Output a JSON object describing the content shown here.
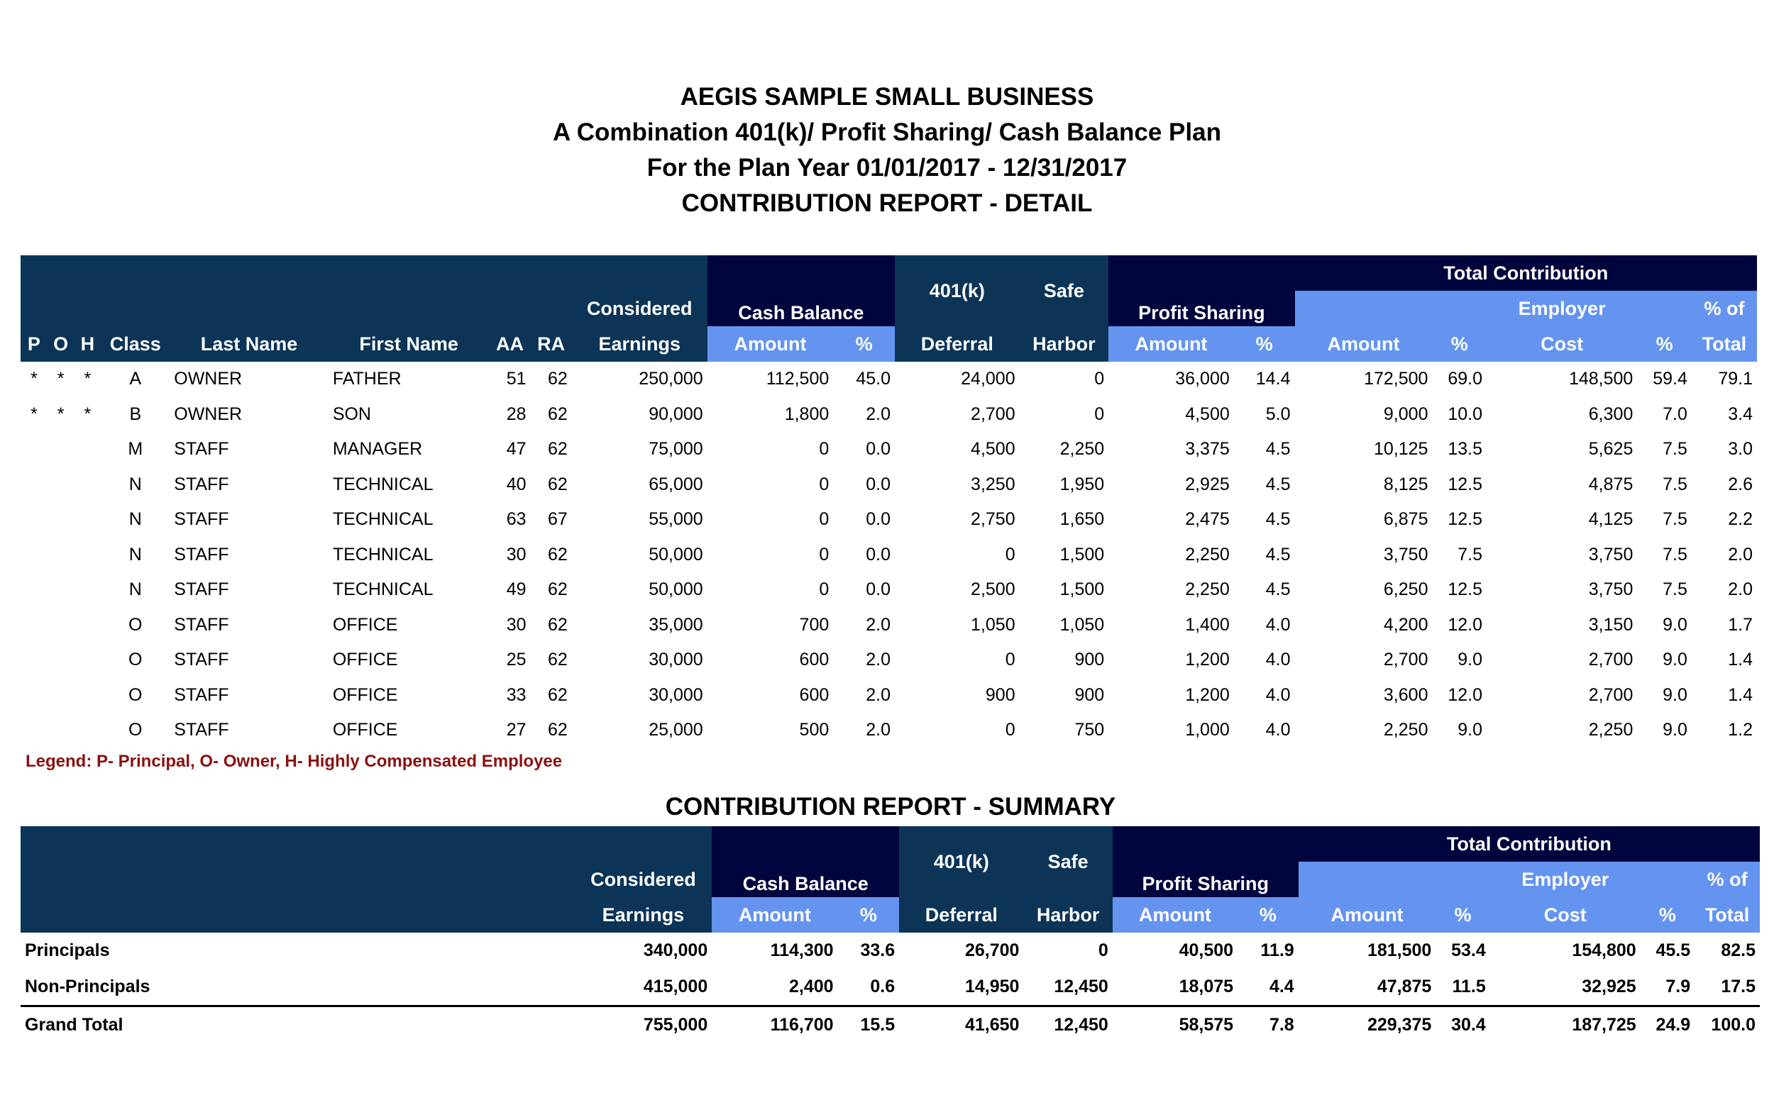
{
  "report": {
    "company": "AEGIS SAMPLE SMALL BUSINESS",
    "plan": "A Combination 401(k)/ Profit Sharing/ Cash Balance Plan",
    "plan_year": "For the Plan Year 01/01/2017 - 12/31/2017",
    "detail_title": "CONTRIBUTION REPORT - DETAIL",
    "summary_title": "CONTRIBUTION REPORT - SUMMARY",
    "legend": "Legend: P- Principal, O- Owner, H- Highly Compensated Employee"
  },
  "headers": {
    "total_contribution": "Total Contribution",
    "considered": "Considered",
    "earnings": "Earnings",
    "cash_balance": "Cash Balance",
    "k401": "401(k)",
    "deferral": "Deferral",
    "safe": "Safe",
    "harbor": "Harbor",
    "profit_sharing": "Profit Sharing",
    "amount": "Amount",
    "pct": "%",
    "employer": "Employer",
    "cost": "Cost",
    "pct_of": "% of",
    "total": "Total",
    "p": "P",
    "o": "O",
    "h": "H",
    "class": "Class",
    "last_name": "Last Name",
    "first_name": "First Name",
    "aa": "AA",
    "ra": "RA"
  },
  "detail_rows": [
    {
      "p": "*",
      "o": "*",
      "h": "*",
      "cls": "A",
      "last": "OWNER",
      "first": "FATHER",
      "aa": "51",
      "ra": "62",
      "earn": "250,000",
      "cb_amt": "112,500",
      "cb_pct": "45.0",
      "def": "24,000",
      "sh": "0",
      "ps_amt": "36,000",
      "ps_pct": "14.4",
      "tc_amt": "172,500",
      "tc_pct": "69.0",
      "er_cost": "148,500",
      "er_pct": "59.4",
      "pct_total": "79.1"
    },
    {
      "p": "*",
      "o": "*",
      "h": "*",
      "cls": "B",
      "last": "OWNER",
      "first": "SON",
      "aa": "28",
      "ra": "62",
      "earn": "90,000",
      "cb_amt": "1,800",
      "cb_pct": "2.0",
      "def": "2,700",
      "sh": "0",
      "ps_amt": "4,500",
      "ps_pct": "5.0",
      "tc_amt": "9,000",
      "tc_pct": "10.0",
      "er_cost": "6,300",
      "er_pct": "7.0",
      "pct_total": "3.4"
    },
    {
      "p": "",
      "o": "",
      "h": "",
      "cls": "M",
      "last": "STAFF",
      "first": "MANAGER",
      "aa": "47",
      "ra": "62",
      "earn": "75,000",
      "cb_amt": "0",
      "cb_pct": "0.0",
      "def": "4,500",
      "sh": "2,250",
      "ps_amt": "3,375",
      "ps_pct": "4.5",
      "tc_amt": "10,125",
      "tc_pct": "13.5",
      "er_cost": "5,625",
      "er_pct": "7.5",
      "pct_total": "3.0"
    },
    {
      "p": "",
      "o": "",
      "h": "",
      "cls": "N",
      "last": "STAFF",
      "first": "TECHNICAL",
      "aa": "40",
      "ra": "62",
      "earn": "65,000",
      "cb_amt": "0",
      "cb_pct": "0.0",
      "def": "3,250",
      "sh": "1,950",
      "ps_amt": "2,925",
      "ps_pct": "4.5",
      "tc_amt": "8,125",
      "tc_pct": "12.5",
      "er_cost": "4,875",
      "er_pct": "7.5",
      "pct_total": "2.6"
    },
    {
      "p": "",
      "o": "",
      "h": "",
      "cls": "N",
      "last": "STAFF",
      "first": "TECHNICAL",
      "aa": "63",
      "ra": "67",
      "earn": "55,000",
      "cb_amt": "0",
      "cb_pct": "0.0",
      "def": "2,750",
      "sh": "1,650",
      "ps_amt": "2,475",
      "ps_pct": "4.5",
      "tc_amt": "6,875",
      "tc_pct": "12.5",
      "er_cost": "4,125",
      "er_pct": "7.5",
      "pct_total": "2.2"
    },
    {
      "p": "",
      "o": "",
      "h": "",
      "cls": "N",
      "last": "STAFF",
      "first": "TECHNICAL",
      "aa": "30",
      "ra": "62",
      "earn": "50,000",
      "cb_amt": "0",
      "cb_pct": "0.0",
      "def": "0",
      "sh": "1,500",
      "ps_amt": "2,250",
      "ps_pct": "4.5",
      "tc_amt": "3,750",
      "tc_pct": "7.5",
      "er_cost": "3,750",
      "er_pct": "7.5",
      "pct_total": "2.0"
    },
    {
      "p": "",
      "o": "",
      "h": "",
      "cls": "N",
      "last": "STAFF",
      "first": "TECHNICAL",
      "aa": "49",
      "ra": "62",
      "earn": "50,000",
      "cb_amt": "0",
      "cb_pct": "0.0",
      "def": "2,500",
      "sh": "1,500",
      "ps_amt": "2,250",
      "ps_pct": "4.5",
      "tc_amt": "6,250",
      "tc_pct": "12.5",
      "er_cost": "3,750",
      "er_pct": "7.5",
      "pct_total": "2.0"
    },
    {
      "p": "",
      "o": "",
      "h": "",
      "cls": "O",
      "last": "STAFF",
      "first": "OFFICE",
      "aa": "30",
      "ra": "62",
      "earn": "35,000",
      "cb_amt": "700",
      "cb_pct": "2.0",
      "def": "1,050",
      "sh": "1,050",
      "ps_amt": "1,400",
      "ps_pct": "4.0",
      "tc_amt": "4,200",
      "tc_pct": "12.0",
      "er_cost": "3,150",
      "er_pct": "9.0",
      "pct_total": "1.7"
    },
    {
      "p": "",
      "o": "",
      "h": "",
      "cls": "O",
      "last": "STAFF",
      "first": "OFFICE",
      "aa": "25",
      "ra": "62",
      "earn": "30,000",
      "cb_amt": "600",
      "cb_pct": "2.0",
      "def": "0",
      "sh": "900",
      "ps_amt": "1,200",
      "ps_pct": "4.0",
      "tc_amt": "2,700",
      "tc_pct": "9.0",
      "er_cost": "2,700",
      "er_pct": "9.0",
      "pct_total": "1.4"
    },
    {
      "p": "",
      "o": "",
      "h": "",
      "cls": "O",
      "last": "STAFF",
      "first": "OFFICE",
      "aa": "33",
      "ra": "62",
      "earn": "30,000",
      "cb_amt": "600",
      "cb_pct": "2.0",
      "def": "900",
      "sh": "900",
      "ps_amt": "1,200",
      "ps_pct": "4.0",
      "tc_amt": "3,600",
      "tc_pct": "12.0",
      "er_cost": "2,700",
      "er_pct": "9.0",
      "pct_total": "1.4"
    },
    {
      "p": "",
      "o": "",
      "h": "",
      "cls": "O",
      "last": "STAFF",
      "first": "OFFICE",
      "aa": "27",
      "ra": "62",
      "earn": "25,000",
      "cb_amt": "500",
      "cb_pct": "2.0",
      "def": "0",
      "sh": "750",
      "ps_amt": "1,000",
      "ps_pct": "4.0",
      "tc_amt": "2,250",
      "tc_pct": "9.0",
      "er_cost": "2,250",
      "er_pct": "9.0",
      "pct_total": "1.2"
    }
  ],
  "summary_rows": [
    {
      "label": "Principals",
      "earn": "340,000",
      "cb_amt": "114,300",
      "cb_pct": "33.6",
      "def": "26,700",
      "sh": "0",
      "ps_amt": "40,500",
      "ps_pct": "11.9",
      "tc_amt": "181,500",
      "tc_pct": "53.4",
      "er_cost": "154,800",
      "er_pct": "45.5",
      "pct_total": "82.5"
    },
    {
      "label": "Non-Principals",
      "earn": "415,000",
      "cb_amt": "2,400",
      "cb_pct": "0.6",
      "def": "14,950",
      "sh": "12,450",
      "ps_amt": "18,075",
      "ps_pct": "4.4",
      "tc_amt": "47,875",
      "tc_pct": "11.5",
      "er_cost": "32,925",
      "er_pct": "7.9",
      "pct_total": "17.5"
    },
    {
      "label": "Grand Total",
      "earn": "755,000",
      "cb_amt": "116,700",
      "cb_pct": "15.5",
      "def": "41,650",
      "sh": "12,450",
      "ps_amt": "58,575",
      "ps_pct": "7.8",
      "tc_amt": "229,375",
      "tc_pct": "30.4",
      "er_cost": "187,725",
      "er_pct": "24.9",
      "pct_total": "100.0"
    }
  ],
  "colors": {
    "header_dark": "#0c3457",
    "header_navy": "#01053e",
    "header_light": "#6494f0",
    "legend_text": "#8b1010"
  }
}
